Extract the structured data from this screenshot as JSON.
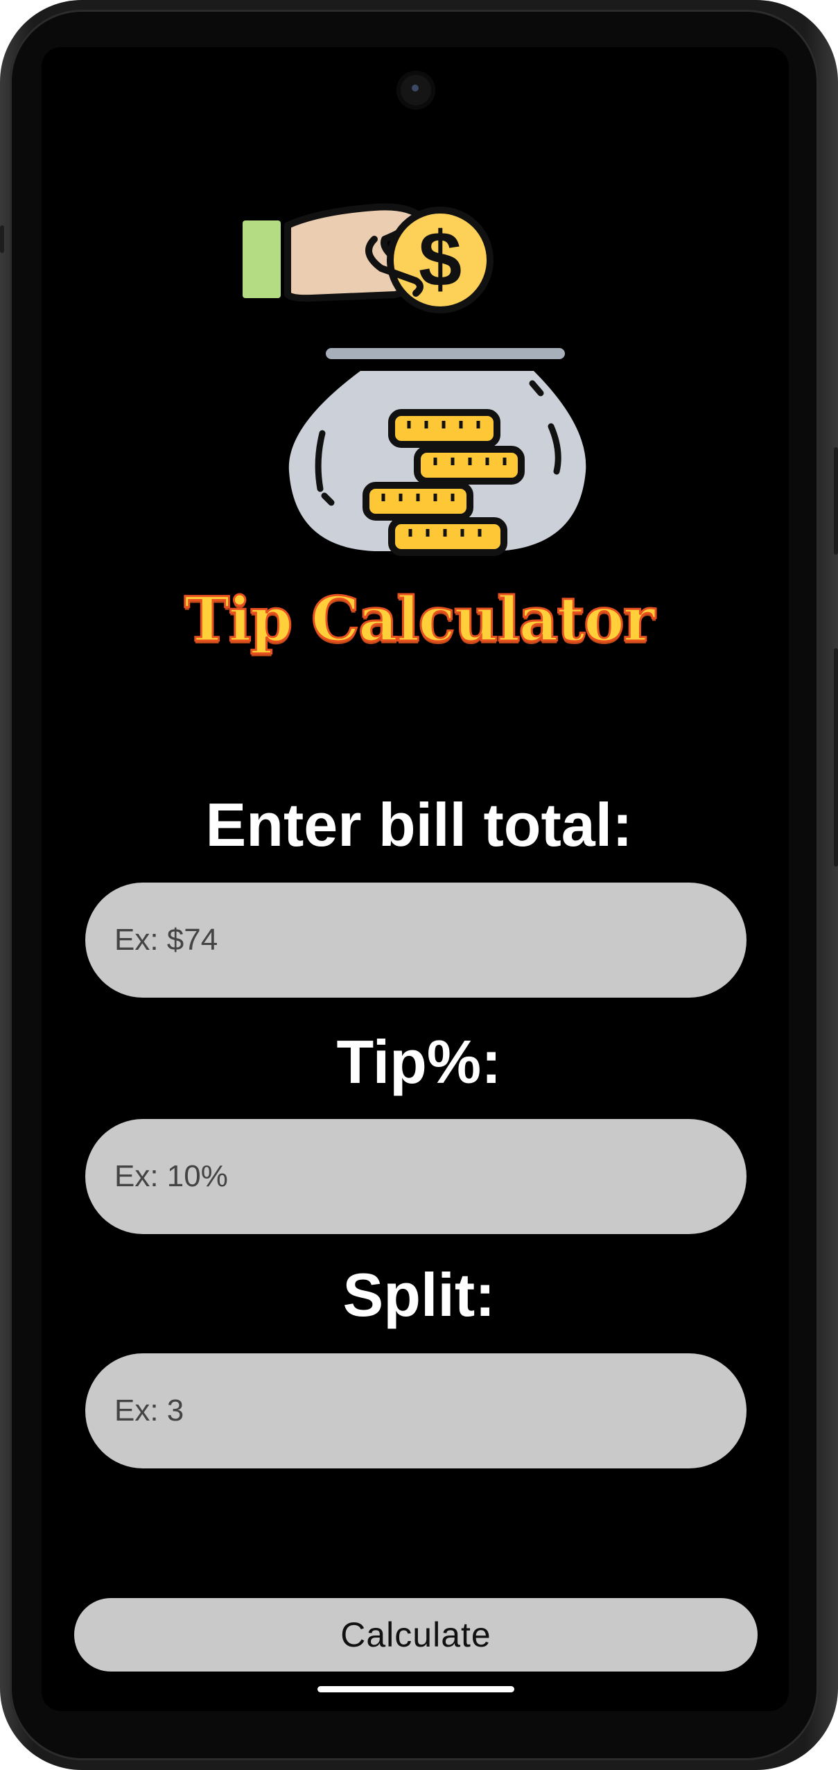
{
  "app": {
    "title": "Tip Calculator"
  },
  "form": {
    "bill_label": "Enter bill total:",
    "bill_placeholder": "Ex: $74",
    "tip_label": "Tip%:",
    "tip_placeholder": "Ex: 10%",
    "split_label": "Split:",
    "split_placeholder": "Ex: 3",
    "calculate_label": "Calculate"
  },
  "icons": {
    "logo": "tip-jar-hand-coin-icon",
    "camera": "front-camera"
  },
  "colors": {
    "background": "#000000",
    "title_fill": "#ffd03a",
    "title_outline": "#e8501f",
    "field_bg": "#c9c9c9",
    "label_text": "#ffffff"
  }
}
